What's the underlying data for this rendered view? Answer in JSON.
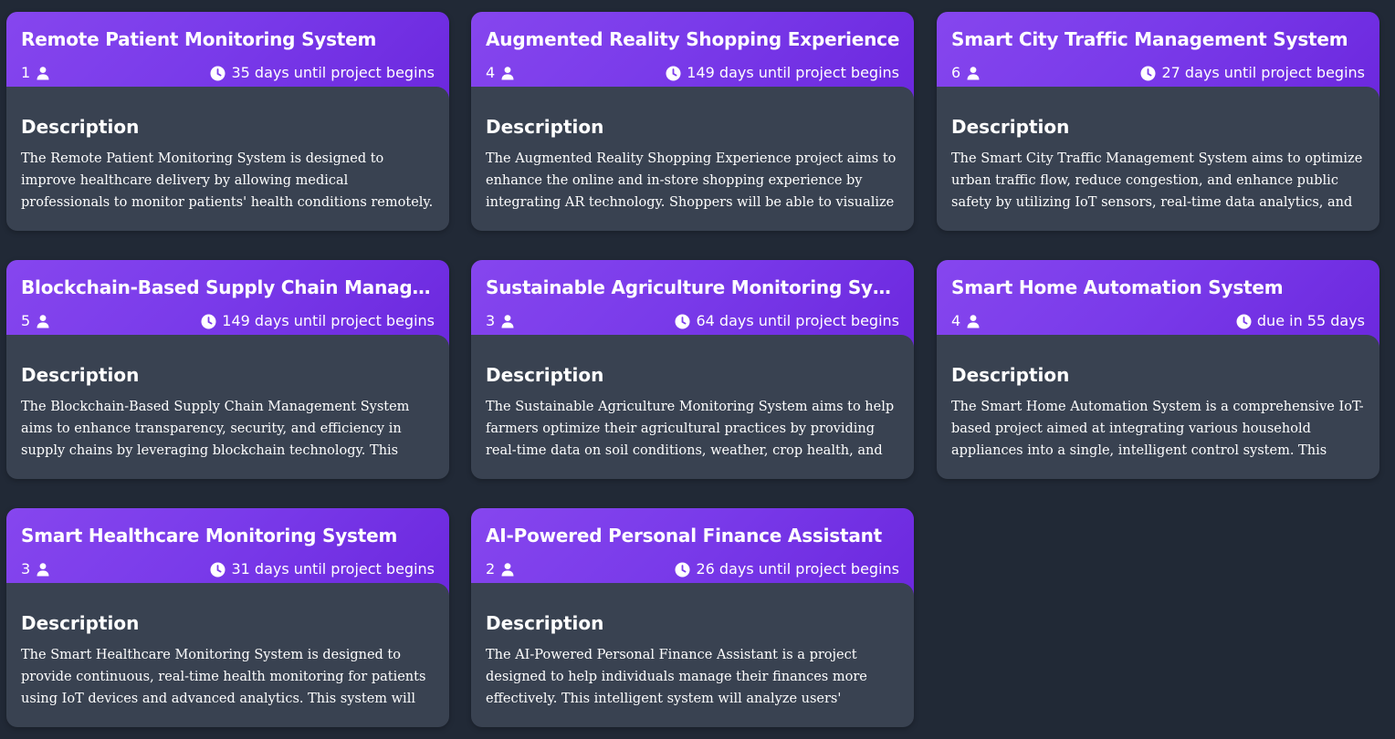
{
  "labels": {
    "description_heading": "Description"
  },
  "icons": {
    "members": "person-icon",
    "due": "clock-icon"
  },
  "colors": {
    "page_background": "#212936",
    "card_body": "#394251",
    "header_gradient_start": "#8646ee",
    "header_gradient_end": "#6c28de",
    "text": "#ffffff"
  },
  "projects": [
    {
      "title": "Remote Patient Monitoring System",
      "members": "1",
      "due": "35 days until project begins",
      "description": "The Remote Patient Monitoring System is designed to improve healthcare delivery by allowing medical professionals to monitor patients' health conditions remotely. Using IoT"
    },
    {
      "title": "Augmented Reality Shopping Experience",
      "members": "4",
      "due": "149 days until project begins",
      "description": "The Augmented Reality Shopping Experience project aims to enhance the online and in-store shopping experience by integrating AR technology. Shoppers will be able to visualize"
    },
    {
      "title": "Smart City Traffic Management System",
      "members": "6",
      "due": "27 days until project begins",
      "description": "The Smart City Traffic Management System aims to optimize urban traffic flow, reduce congestion, and enhance public safety by utilizing IoT sensors, real-time data analytics, and"
    },
    {
      "title": "Blockchain-Based Supply Chain Managem...",
      "members": "5",
      "due": "149 days until project begins",
      "description": "The Blockchain-Based Supply Chain Management System aims to enhance transparency, security, and efficiency in supply chains by leveraging blockchain technology. This system will"
    },
    {
      "title": "Sustainable Agriculture Monitoring System",
      "members": "3",
      "due": "64 days until project begins",
      "description": "The Sustainable Agriculture Monitoring System aims to help farmers optimize their agricultural practices by providing real-time data on soil conditions, weather, crop health, and"
    },
    {
      "title": "Smart Home Automation System",
      "members": "4",
      "due": "due in 55 days",
      "description": "The Smart Home Automation System is a comprehensive IoT-based project aimed at integrating various household appliances into a single, intelligent control system. This system"
    },
    {
      "title": "Smart Healthcare Monitoring System",
      "members": "3",
      "due": "31 days until project begins",
      "description": "The Smart Healthcare Monitoring System is designed to provide continuous, real-time health monitoring for patients using IoT devices and advanced analytics. This system will"
    },
    {
      "title": "AI-Powered Personal Finance Assistant",
      "members": "2",
      "due": "26 days until project begins",
      "description": "The AI-Powered Personal Finance Assistant is a project designed to help individuals manage their finances more effectively. This intelligent system will analyze users' financial"
    }
  ]
}
